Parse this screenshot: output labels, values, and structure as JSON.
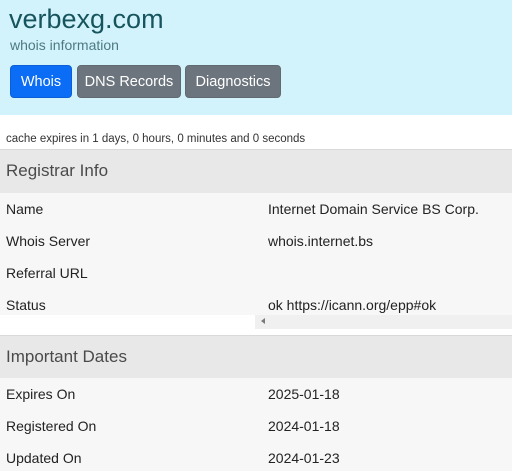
{
  "header": {
    "domain": "verbexg.com",
    "subtitle": "whois information",
    "tabs": {
      "whois": "Whois",
      "dns": "DNS Records",
      "diagnostics": "Diagnostics"
    }
  },
  "cache_note": "cache expires in 1 days, 0 hours, 0 minutes and 0 seconds",
  "registrar": {
    "title": "Registrar Info",
    "rows": [
      {
        "label": "Name",
        "value": "Internet Domain Service BS Corp."
      },
      {
        "label": "Whois Server",
        "value": "whois.internet.bs"
      },
      {
        "label": "Referral URL",
        "value": ""
      },
      {
        "label": "Status",
        "value": "ok https://icann.org/epp#ok"
      }
    ]
  },
  "dates": {
    "title": "Important Dates",
    "rows": [
      {
        "label": "Expires On",
        "value": "2025-01-18"
      },
      {
        "label": "Registered On",
        "value": "2024-01-18"
      },
      {
        "label": "Updated On",
        "value": "2024-01-23"
      }
    ]
  },
  "icons": {
    "scroll_left": "chevron-left-icon"
  },
  "colors": {
    "header_bg": "#d3f3fc",
    "title": "#17555e",
    "active_tab": "#0b6cf5",
    "inactive_tab": "#6c757d",
    "section_bg": "#e8e8e8",
    "row_bg": "#f7f7f7"
  }
}
